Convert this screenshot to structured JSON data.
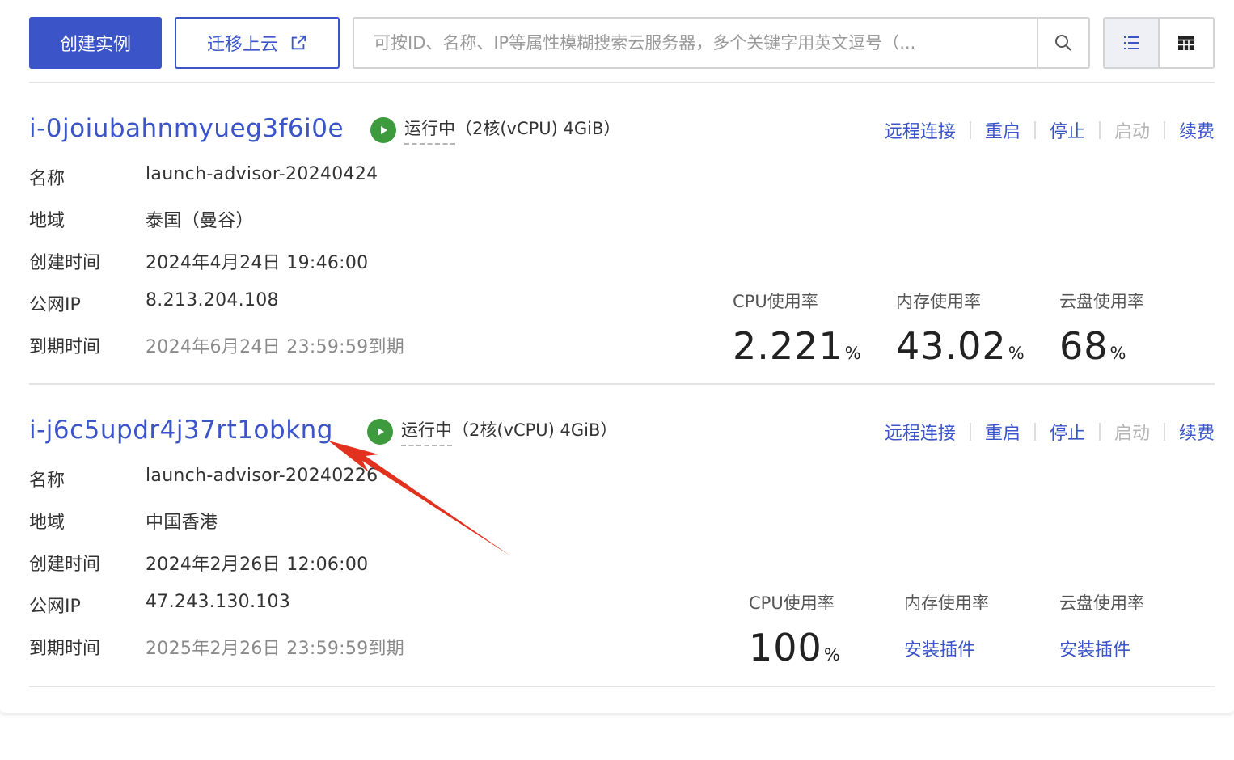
{
  "toolbar": {
    "create_label": "创建实例",
    "migrate_label": "迁移上云",
    "search_placeholder": "可按ID、名称、IP等属性模糊搜索云服务器，多个关键字用英文逗号（..."
  },
  "instances": [
    {
      "id": "i-0joiubahnmyueg3f6i0e",
      "state": "运行中",
      "spec": "（2核(vCPU) 4GiB）",
      "actions": [
        "远程连接",
        "重启",
        "停止",
        "启动",
        "续费"
      ],
      "fields": [
        {
          "label": "名称",
          "value": "launch-advisor-20240424"
        },
        {
          "label": "地域",
          "value": "泰国（曼谷）"
        },
        {
          "label": "创建时间",
          "value": "2024年4月24日 19:46:00"
        },
        {
          "label": "公网IP",
          "value": "8.213.204.108"
        },
        {
          "label": "到期时间",
          "value": "2024年6月24日 23:59:59到期"
        }
      ],
      "metrics": [
        {
          "label": "CPU使用率",
          "value": "2.221",
          "unit": "%"
        },
        {
          "label": "内存使用率",
          "value": "43.02",
          "unit": "%"
        },
        {
          "label": "云盘使用率",
          "value": "68",
          "unit": "%"
        }
      ]
    },
    {
      "id": "i-j6c5updr4j37rt1obkng",
      "state": "运行中",
      "spec": "（2核(vCPU) 4GiB）",
      "actions": [
        "远程连接",
        "重启",
        "停止",
        "启动",
        "续费"
      ],
      "fields": [
        {
          "label": "名称",
          "value": "launch-advisor-20240226"
        },
        {
          "label": "地域",
          "value": "中国香港"
        },
        {
          "label": "创建时间",
          "value": "2024年2月26日 12:06:00"
        },
        {
          "label": "公网IP",
          "value": "47.243.130.103"
        },
        {
          "label": "到期时间",
          "value": "2025年2月26日 23:59:59到期"
        }
      ],
      "metrics": [
        {
          "label": "CPU使用率",
          "value": "100",
          "unit": "%"
        },
        {
          "label": "内存使用率",
          "link": "安装插件"
        },
        {
          "label": "云盘使用率",
          "link": "安装插件"
        }
      ]
    }
  ],
  "colors": {
    "primary": "#3b55c8",
    "running": "#3d9a3d",
    "annotation_arrow": "#e0321f",
    "disabled": "#b5b5b5"
  }
}
